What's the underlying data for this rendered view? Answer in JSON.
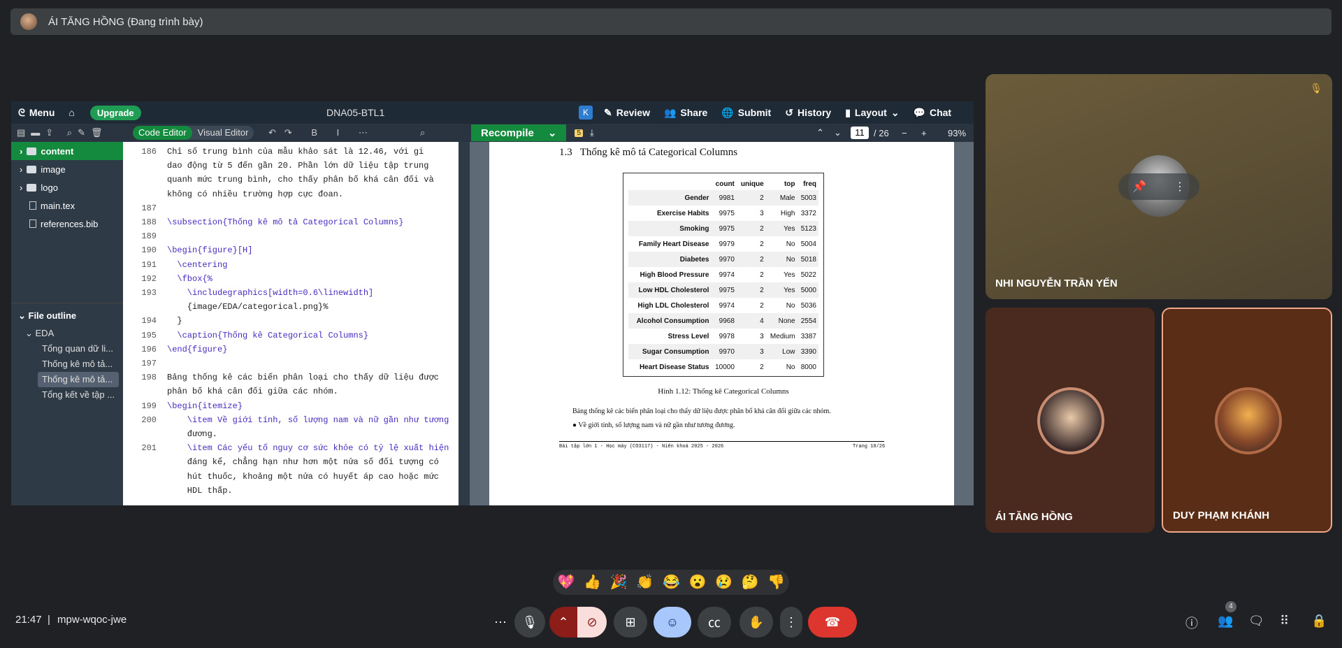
{
  "presenter": {
    "label": "ÁI TĂNG HỒNG (Đang trình bày)"
  },
  "overleaf": {
    "menu": "Menu",
    "upgrade": "Upgrade",
    "project": "DNA05-BTL1",
    "k_badge": "K",
    "review": "Review",
    "share": "Share",
    "submit": "Submit",
    "history": "History",
    "layout": "Layout",
    "chat": "Chat",
    "code_editor": "Code Editor",
    "visual_editor": "Visual Editor",
    "recompile": "Recompile",
    "page_current": "11",
    "page_total": "/ 26",
    "zoom": "93%",
    "badge": "5",
    "files": [
      {
        "label": "content",
        "type": "folder"
      },
      {
        "label": "image",
        "type": "folder"
      },
      {
        "label": "logo",
        "type": "folder"
      },
      {
        "label": "main.tex",
        "type": "file"
      },
      {
        "label": "references.bib",
        "type": "file"
      }
    ],
    "outline_title": "File outline",
    "outline": [
      "EDA",
      "Tổng quan dữ li...",
      "Thống kê mô tả...",
      "Thống kê mô tả...",
      "Tổng kết về tập ..."
    ],
    "lines": [
      {
        "n": "186",
        "t": "Chỉ số trung bình của mẫu khảo sát là 12.46, với gi"
      },
      {
        "n": "",
        "t": "dao động từ 5 đến gần 20. Phần lớn dữ liệu tập trung"
      },
      {
        "n": "",
        "t": "quanh mức trung bình, cho thấy phân bố khá cân đối và"
      },
      {
        "n": "",
        "t": "không có nhiều trường hợp cực đoan."
      },
      {
        "n": "187",
        "t": ""
      },
      {
        "n": "188",
        "t": "\\subsection{Thống kê mô tả Categorical Columns}"
      },
      {
        "n": "189",
        "t": ""
      },
      {
        "n": "190",
        "t": "\\begin{figure}[H]"
      },
      {
        "n": "191",
        "t": "  \\centering"
      },
      {
        "n": "192",
        "t": "  \\fbox{%"
      },
      {
        "n": "193",
        "t": "    \\includegraphics[width=0.6\\linewidth]"
      },
      {
        "n": "",
        "t": "    {image/EDA/categorical.png}%"
      },
      {
        "n": "194",
        "t": "  }"
      },
      {
        "n": "195",
        "t": "  \\caption{Thống kê Categorical Columns}"
      },
      {
        "n": "196",
        "t": "\\end{figure}"
      },
      {
        "n": "197",
        "t": ""
      },
      {
        "n": "198",
        "t": "Bảng thống kê các biến phân loại cho thấy dữ liệu được"
      },
      {
        "n": "",
        "t": "phân bố khá cân đối giữa các nhóm."
      },
      {
        "n": "199",
        "t": "\\begin{itemize}"
      },
      {
        "n": "200",
        "t": "    \\item Về giới tính, số lượng nam và nữ gần như tương"
      },
      {
        "n": "",
        "t": "    đương."
      },
      {
        "n": "201",
        "t": "    \\item Các yếu tố nguy cơ sức khỏe có tỷ lệ xuất hiện"
      },
      {
        "n": "",
        "t": "    đáng kể, chẳng hạn như hơn một nửa số đối tượng có"
      },
      {
        "n": "",
        "t": "    hút thuốc, khoảng một nửa có huyết áp cao hoặc mức"
      },
      {
        "n": "",
        "t": "    HDL thấp."
      }
    ],
    "pdf": {
      "section": "1.3   Thống kê mô tả Categorical Columns",
      "headers": [
        "",
        "count",
        "unique",
        "top",
        "freq"
      ],
      "rows": [
        [
          "Gender",
          "9981",
          "2",
          "Male",
          "5003"
        ],
        [
          "Exercise Habits",
          "9975",
          "3",
          "High",
          "3372"
        ],
        [
          "Smoking",
          "9975",
          "2",
          "Yes",
          "5123"
        ],
        [
          "Family Heart Disease",
          "9979",
          "2",
          "No",
          "5004"
        ],
        [
          "Diabetes",
          "9970",
          "2",
          "No",
          "5018"
        ],
        [
          "High Blood Pressure",
          "9974",
          "2",
          "Yes",
          "5022"
        ],
        [
          "Low HDL Cholesterol",
          "9975",
          "2",
          "Yes",
          "5000"
        ],
        [
          "High LDL Cholesterol",
          "9974",
          "2",
          "No",
          "5036"
        ],
        [
          "Alcohol Consumption",
          "9968",
          "4",
          "None",
          "2554"
        ],
        [
          "Stress Level",
          "9978",
          "3",
          "Medium",
          "3387"
        ],
        [
          "Sugar Consumption",
          "9970",
          "3",
          "Low",
          "3390"
        ],
        [
          "Heart Disease Status",
          "10000",
          "2",
          "No",
          "8000"
        ]
      ],
      "caption": "Hình 1.12: Thống kê Categorical Columns",
      "para": "Bảng thống kê các biến phân loại cho thấy dữ liệu được phân bố khá cân đối giữa các nhóm.",
      "bullet": "Về giới tính, số lượng nam và nữ gần như tương đương.",
      "footer_left": "Bài tập lớn 1 - Học máy (CO3117) - Niên khoá 2025 - 2026",
      "footer_right": "Trang 10/26"
    }
  },
  "participants": [
    {
      "name": "NHI NGUYỄN TRẦN YẾN"
    },
    {
      "name": "ÁI TĂNG HỒNG"
    },
    {
      "name": "DUY PHẠM KHÁNH"
    }
  ],
  "meeting": {
    "time": "21:47",
    "code": "mpw-wqoc-jwe",
    "people_count": "4"
  },
  "reactions": [
    "💖",
    "👍",
    "🎉",
    "👏",
    "😂",
    "😮",
    "😢",
    "🤔",
    "👎"
  ]
}
